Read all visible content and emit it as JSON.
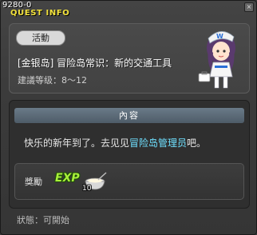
{
  "window": {
    "quest_id": "9280-0",
    "title": "QUEST INFO",
    "close_label": "×"
  },
  "quest": {
    "category": "活動",
    "name": "[金银岛] 冒险岛常识：新的交通工具",
    "level_range": "建議等级：8～12"
  },
  "content": {
    "header": "內容",
    "text_before": "快乐的新年到了。去见见",
    "text_link": "冒险岛管理员",
    "text_after": "吧。"
  },
  "reward": {
    "label": "獎勵",
    "exp_icon_text": "EXP",
    "item_icon": "bowl-icon",
    "item_quantity": "10"
  },
  "status": {
    "text": "狀態：可開始"
  },
  "colors": {
    "title": "#f3e23c",
    "link": "#6fe0ff",
    "exp": "#a8f03a"
  }
}
